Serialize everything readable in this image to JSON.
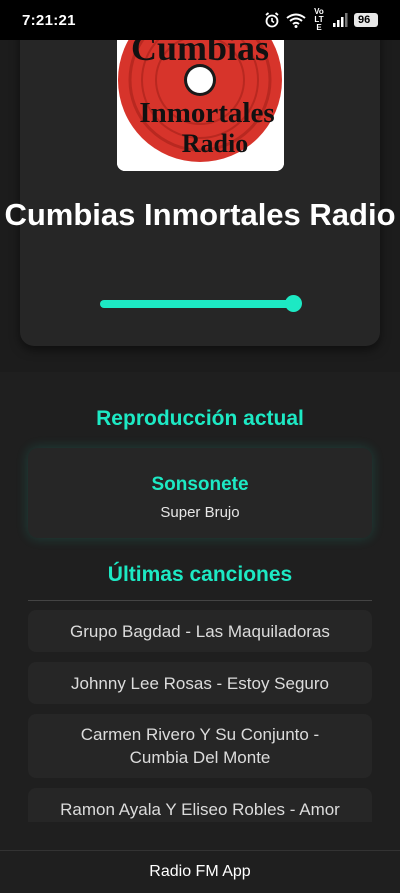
{
  "status_bar": {
    "time": "7:21:21",
    "network_label": "Vo LTE",
    "battery": "96",
    "icons": [
      "alarm-icon",
      "wifi-icon",
      "signal-icon",
      "battery-icon"
    ]
  },
  "station": {
    "album_art": {
      "line1": "Cumbias",
      "line2": "Inmortales",
      "line3": "Radio",
      "colors": {
        "disc": "#d7342b",
        "ring": "#1a1a1a",
        "text": "#111111"
      }
    },
    "title": "Cumbias Inmortales Radio",
    "volume_level": 0.95
  },
  "now_playing": {
    "heading": "Reproducción actual",
    "song": "Sonsonete",
    "artist": "Super Brujo"
  },
  "history": {
    "heading": "Últimas canciones",
    "items": [
      "Grupo Bagdad - Las Maquiladoras",
      "Johnny Lee Rosas - Estoy Seguro",
      "Carmen Rivero Y Su Conjunto - Cumbia Del Monte",
      "Ramon Ayala Y Eliseo Robles - Amor"
    ]
  },
  "footer": {
    "label": "Radio FM App"
  },
  "colors": {
    "accent": "#1de9c4",
    "background": "#1c1c1c",
    "card": "#262626"
  }
}
